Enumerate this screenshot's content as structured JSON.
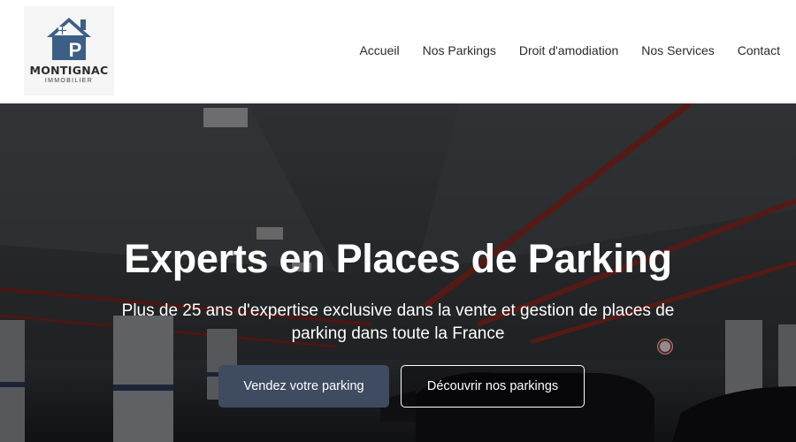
{
  "header": {
    "logo": {
      "icon": "house-p-icon",
      "brand": "MONTIGNAC",
      "sub": "IMMOBILIER",
      "color": "#3d5f86"
    },
    "nav": [
      {
        "label": "Accueil"
      },
      {
        "label": "Nos Parkings"
      },
      {
        "label": "Droit d'amodiation"
      },
      {
        "label": "Nos Services"
      },
      {
        "label": "Contact"
      }
    ]
  },
  "hero": {
    "title": "Experts en Places de Parking",
    "subtitle": "Plus de 25 ans d'expertise exclusive dans la vente et gestion de places de parking dans toute la France",
    "primary_button": "Vendez votre parking",
    "secondary_button": "Découvrir nos parkings",
    "primary_color": "#3e4b60"
  }
}
